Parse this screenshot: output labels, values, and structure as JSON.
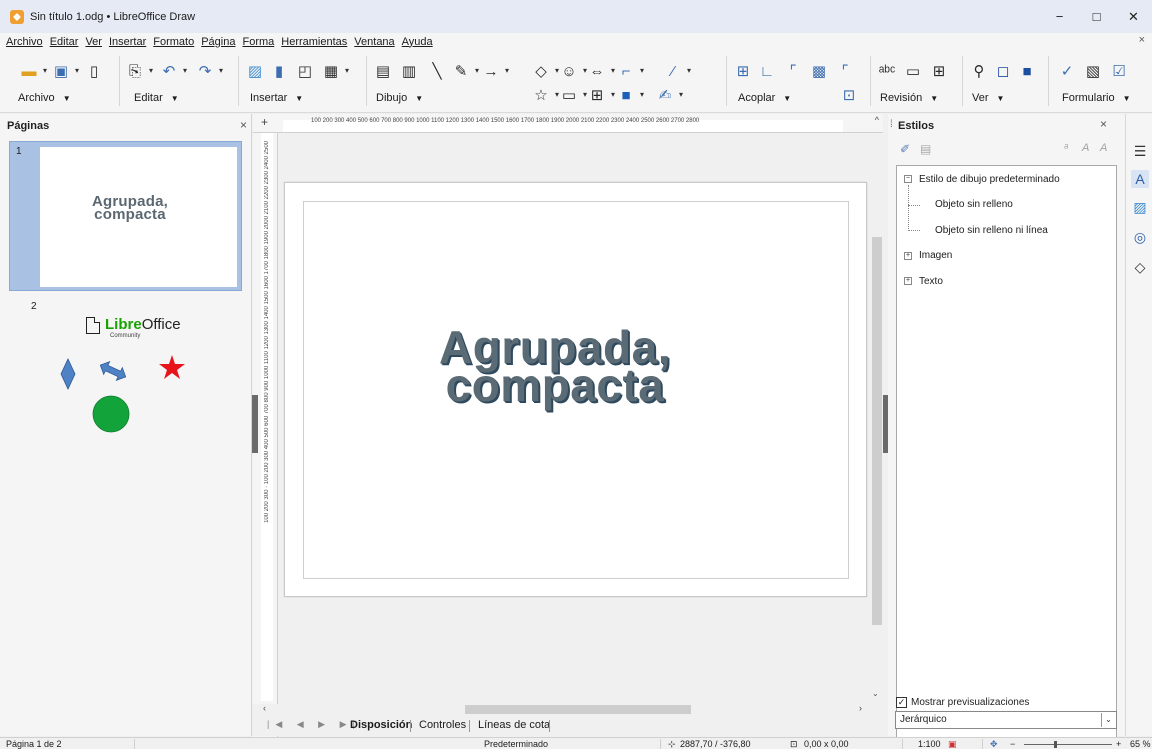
{
  "window": {
    "title": "Sin título 1.odg • LibreOffice Draw",
    "minimize": "−",
    "maximize": "□",
    "close": "✕"
  },
  "menubar": {
    "items": [
      "Archivo",
      "Editar",
      "Ver",
      "Insertar",
      "Formato",
      "Página",
      "Forma",
      "Herramientas",
      "Ventana",
      "Ayuda"
    ],
    "close_doc": "×"
  },
  "toolbar": {
    "groups": [
      {
        "label": "Archivo"
      },
      {
        "label": "Editar"
      },
      {
        "label": "Insertar"
      },
      {
        "label": "Dibujo"
      },
      {
        "label": "Acoplar"
      },
      {
        "label": "Revisión"
      },
      {
        "label": "Ver"
      },
      {
        "label": "Formulario"
      }
    ],
    "arrow": "▼"
  },
  "slides_panel": {
    "title": "Páginas",
    "close": "×",
    "slides": [
      {
        "number": "1",
        "text_line1": "Agrupada,",
        "text_line2": "compacta"
      },
      {
        "number": "2",
        "logo_libre": "Libre",
        "logo_office": "Office",
        "logo_sub": "Community"
      }
    ]
  },
  "canvas": {
    "text_line1": "Agrupada,",
    "text_line2": "compacta",
    "text_color": "#5a6b76"
  },
  "rulers": {
    "horizontal_ticks": "100  200  300  400  500  600  700  800  900  1000 1100 1200 1300 1400 1500 1600 1700 1800 1900 2000 2100 2200 2300 2400 2500 2600 2700 2800",
    "vertical_ticks": "100  200  300  ·  100  200  300  400  500  600  700  800  900  1000 1100 1200 1300 1400 1500 1600 1700 1800 1900 2000 2100 2200 2300 2400 2500"
  },
  "layer_tabs": {
    "tabs": [
      "Disposición",
      "Controles",
      "Líneas de cota"
    ],
    "active": 0,
    "nav": "|◀ ◀ ▶ ▶|"
  },
  "styles_panel": {
    "title": "Estilos",
    "close": "×",
    "menu": "≡",
    "items": [
      {
        "label": "Estilo de dibujo predeterminado",
        "expander": "−"
      },
      {
        "label": "Objeto sin relleno"
      },
      {
        "label": "Objeto sin relleno ni línea"
      },
      {
        "label": "Imagen",
        "expander": "+"
      },
      {
        "label": "Texto",
        "expander": "+"
      }
    ],
    "show_previews_label": "Mostrar previsualizaciones",
    "show_previews_checked": "✓",
    "filter_value": "Jerárquico",
    "filter_arrow": "⌄"
  },
  "statusbar": {
    "page": "Página 1 de 2",
    "style": "Predeterminado",
    "position": "2887,70 / -376,80",
    "size": "0,00 x 0,00",
    "scale": "1:100",
    "zoom": "65 %"
  },
  "colors": {
    "accent": "#2f5fa8",
    "libre_green": "#18a303",
    "shape_blue": "#4f82c4",
    "star_red": "#e8141c",
    "circle_green": "#12a33a"
  }
}
